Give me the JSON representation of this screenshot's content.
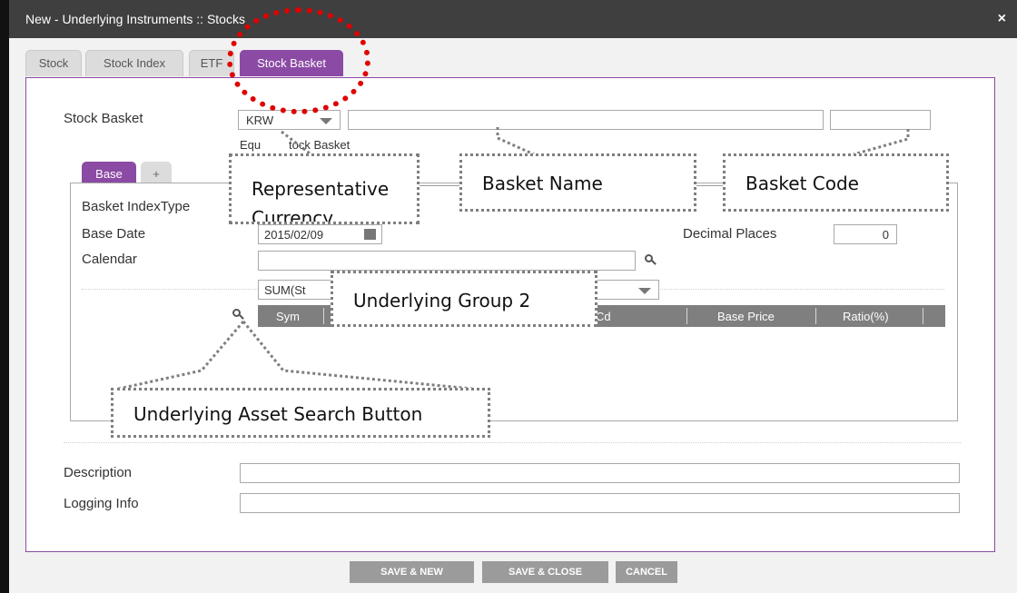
{
  "window": {
    "title": "New - Underlying Instruments :: Stocks",
    "close": "×"
  },
  "tabs": [
    {
      "label": "Stock"
    },
    {
      "label": "Stock Index"
    },
    {
      "label": "ETF"
    },
    {
      "label": "Stock Basket"
    }
  ],
  "form": {
    "stock_basket_label": "Stock Basket",
    "currency": "KRW",
    "basket_name": "",
    "basket_code": "",
    "sub_label": "Equity Stock Basket",
    "sub_label_visible": "Equ",
    "sub_label_visible2": "tock Basket",
    "inner_tabs": {
      "base": "Base",
      "add": "+"
    },
    "basket_index_type_label": "Basket IndexType",
    "base_date_label": "Base Date",
    "base_date": "2015/02/09",
    "calendar_label": "Calendar",
    "calendar_value": "",
    "decimal_places_label": "Decimal Places",
    "decimal_places": "0",
    "group_select": "SUM(St",
    "columns": [
      "Sym",
      "Cd",
      "Base Price",
      "Ratio(%)"
    ],
    "description_label": "Description",
    "description": "",
    "logging_label": "Logging Info",
    "logging": ""
  },
  "buttons": {
    "save_new": "SAVE & NEW",
    "save_close": "SAVE & CLOSE",
    "cancel": "CANCEL"
  },
  "callouts": {
    "representative_currency": "Representative Currency",
    "basket_name": "Basket Name",
    "basket_code": "Basket Code",
    "underlying_group": "Underlying Group 2",
    "search_button": "Underlying Asset Search Button"
  },
  "colors": {
    "accent": "#8b4aa4",
    "titlebar": "#3f3f3f",
    "button": "#9b9b9b",
    "highlight": "#e00000"
  }
}
